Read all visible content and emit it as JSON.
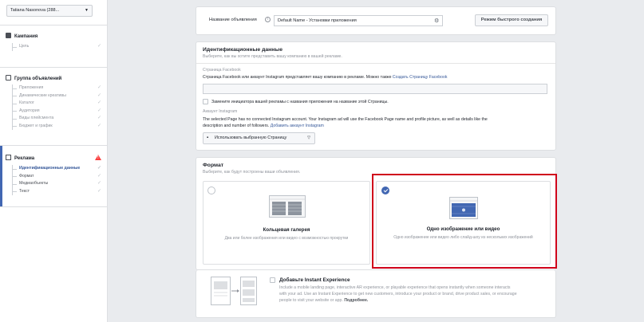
{
  "account": {
    "name": "Tatiana Nasonova (288..."
  },
  "sidebar": {
    "campaign": {
      "title": "Кампания",
      "items": [
        {
          "label": "Цель"
        }
      ]
    },
    "adset": {
      "title": "Группа объявлений",
      "items": [
        {
          "label": "Приложения"
        },
        {
          "label": "Динамические креативы"
        },
        {
          "label": "Каталог"
        },
        {
          "label": "Аудитория"
        },
        {
          "label": "Виды плейсмента"
        },
        {
          "label": "Бюджет и график"
        }
      ]
    },
    "ad": {
      "title": "Реклама",
      "items": [
        {
          "label": "Идентификационные данные"
        },
        {
          "label": "Формат"
        },
        {
          "label": "Медиаобъекты"
        },
        {
          "label": "Текст"
        }
      ]
    }
  },
  "name_card": {
    "label": "Название объявления",
    "value": "Default Name - Установки приложения",
    "quick_create": "Режим быстрого создания"
  },
  "identity": {
    "title": "Идентификационные данные",
    "subtitle": "Выберите, как вы хотите представить вашу компанию в вашей рекламе.",
    "fb_page_label": "Страница Facebook",
    "fb_page_text": "Страница Facebook или аккаунт Instagram представляет вашу компанию в рекламе. Можно также",
    "fb_page_link": "Создать Страницу Facebook",
    "replace_checkbox": "Замените инициатора вашей рекламы с названия приложения на название этой Страницы.",
    "ig_label": "Аккаунт Instagram",
    "ig_text_1": "The selected Page has no connected Instagram account. Your Instagram ad will use the Facebook Page name and profile picture, as well as details like the",
    "ig_text_2": "description and number of followers.",
    "ig_link": "Добавить аккаунт Instagram",
    "use_page_btn": "Использовать выбранную Страницу"
  },
  "format": {
    "title": "Формат",
    "subtitle": "Выберите, как будут построены ваши объявления.",
    "carousel": {
      "title": "Кольцевая галерея",
      "desc": "Два или более изображения или видео с возможностью прокрутки"
    },
    "single": {
      "title": "Одно изображение или видео",
      "desc": "Одно изображение или видео либо слайд-шоу из нескольких изображений"
    }
  },
  "instant": {
    "title": "Добавьте Instant Experience",
    "line1": "Include a mobile landing page, interactive AR experience, or playable experience that opens instantly when someone interacts",
    "line2": "with your ad. Use an Instant Experience to get new customers, introduce your product or brand, drive product sales, or encourage",
    "line3": "people to visit your website or app.",
    "more": "Подробнее."
  },
  "colors": {
    "accent": "#4267b2",
    "highlight": "#d0021b",
    "warning": "#fa3e3e"
  }
}
